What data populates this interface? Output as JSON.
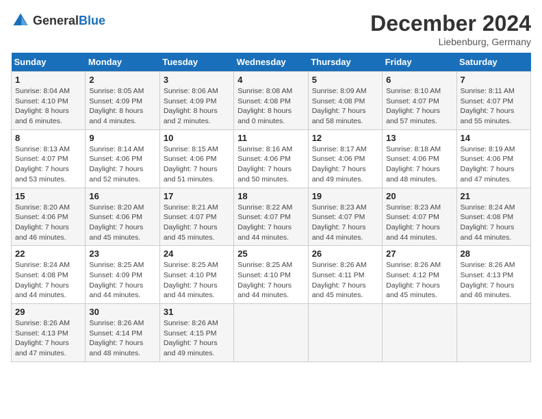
{
  "header": {
    "logo_general": "General",
    "logo_blue": "Blue",
    "month_title": "December 2024",
    "location": "Liebenburg, Germany"
  },
  "weekdays": [
    "Sunday",
    "Monday",
    "Tuesday",
    "Wednesday",
    "Thursday",
    "Friday",
    "Saturday"
  ],
  "weeks": [
    [
      {
        "day": "1",
        "sunrise": "Sunrise: 8:04 AM",
        "sunset": "Sunset: 4:10 PM",
        "daylight": "Daylight: 8 hours and 6 minutes."
      },
      {
        "day": "2",
        "sunrise": "Sunrise: 8:05 AM",
        "sunset": "Sunset: 4:09 PM",
        "daylight": "Daylight: 8 hours and 4 minutes."
      },
      {
        "day": "3",
        "sunrise": "Sunrise: 8:06 AM",
        "sunset": "Sunset: 4:09 PM",
        "daylight": "Daylight: 8 hours and 2 minutes."
      },
      {
        "day": "4",
        "sunrise": "Sunrise: 8:08 AM",
        "sunset": "Sunset: 4:08 PM",
        "daylight": "Daylight: 8 hours and 0 minutes."
      },
      {
        "day": "5",
        "sunrise": "Sunrise: 8:09 AM",
        "sunset": "Sunset: 4:08 PM",
        "daylight": "Daylight: 7 hours and 58 minutes."
      },
      {
        "day": "6",
        "sunrise": "Sunrise: 8:10 AM",
        "sunset": "Sunset: 4:07 PM",
        "daylight": "Daylight: 7 hours and 57 minutes."
      },
      {
        "day": "7",
        "sunrise": "Sunrise: 8:11 AM",
        "sunset": "Sunset: 4:07 PM",
        "daylight": "Daylight: 7 hours and 55 minutes."
      }
    ],
    [
      {
        "day": "8",
        "sunrise": "Sunrise: 8:13 AM",
        "sunset": "Sunset: 4:07 PM",
        "daylight": "Daylight: 7 hours and 53 minutes."
      },
      {
        "day": "9",
        "sunrise": "Sunrise: 8:14 AM",
        "sunset": "Sunset: 4:06 PM",
        "daylight": "Daylight: 7 hours and 52 minutes."
      },
      {
        "day": "10",
        "sunrise": "Sunrise: 8:15 AM",
        "sunset": "Sunset: 4:06 PM",
        "daylight": "Daylight: 7 hours and 51 minutes."
      },
      {
        "day": "11",
        "sunrise": "Sunrise: 8:16 AM",
        "sunset": "Sunset: 4:06 PM",
        "daylight": "Daylight: 7 hours and 50 minutes."
      },
      {
        "day": "12",
        "sunrise": "Sunrise: 8:17 AM",
        "sunset": "Sunset: 4:06 PM",
        "daylight": "Daylight: 7 hours and 49 minutes."
      },
      {
        "day": "13",
        "sunrise": "Sunrise: 8:18 AM",
        "sunset": "Sunset: 4:06 PM",
        "daylight": "Daylight: 7 hours and 48 minutes."
      },
      {
        "day": "14",
        "sunrise": "Sunrise: 8:19 AM",
        "sunset": "Sunset: 4:06 PM",
        "daylight": "Daylight: 7 hours and 47 minutes."
      }
    ],
    [
      {
        "day": "15",
        "sunrise": "Sunrise: 8:20 AM",
        "sunset": "Sunset: 4:06 PM",
        "daylight": "Daylight: 7 hours and 46 minutes."
      },
      {
        "day": "16",
        "sunrise": "Sunrise: 8:20 AM",
        "sunset": "Sunset: 4:06 PM",
        "daylight": "Daylight: 7 hours and 45 minutes."
      },
      {
        "day": "17",
        "sunrise": "Sunrise: 8:21 AM",
        "sunset": "Sunset: 4:07 PM",
        "daylight": "Daylight: 7 hours and 45 minutes."
      },
      {
        "day": "18",
        "sunrise": "Sunrise: 8:22 AM",
        "sunset": "Sunset: 4:07 PM",
        "daylight": "Daylight: 7 hours and 44 minutes."
      },
      {
        "day": "19",
        "sunrise": "Sunrise: 8:23 AM",
        "sunset": "Sunset: 4:07 PM",
        "daylight": "Daylight: 7 hours and 44 minutes."
      },
      {
        "day": "20",
        "sunrise": "Sunrise: 8:23 AM",
        "sunset": "Sunset: 4:07 PM",
        "daylight": "Daylight: 7 hours and 44 minutes."
      },
      {
        "day": "21",
        "sunrise": "Sunrise: 8:24 AM",
        "sunset": "Sunset: 4:08 PM",
        "daylight": "Daylight: 7 hours and 44 minutes."
      }
    ],
    [
      {
        "day": "22",
        "sunrise": "Sunrise: 8:24 AM",
        "sunset": "Sunset: 4:08 PM",
        "daylight": "Daylight: 7 hours and 44 minutes."
      },
      {
        "day": "23",
        "sunrise": "Sunrise: 8:25 AM",
        "sunset": "Sunset: 4:09 PM",
        "daylight": "Daylight: 7 hours and 44 minutes."
      },
      {
        "day": "24",
        "sunrise": "Sunrise: 8:25 AM",
        "sunset": "Sunset: 4:10 PM",
        "daylight": "Daylight: 7 hours and 44 minutes."
      },
      {
        "day": "25",
        "sunrise": "Sunrise: 8:25 AM",
        "sunset": "Sunset: 4:10 PM",
        "daylight": "Daylight: 7 hours and 44 minutes."
      },
      {
        "day": "26",
        "sunrise": "Sunrise: 8:26 AM",
        "sunset": "Sunset: 4:11 PM",
        "daylight": "Daylight: 7 hours and 45 minutes."
      },
      {
        "day": "27",
        "sunrise": "Sunrise: 8:26 AM",
        "sunset": "Sunset: 4:12 PM",
        "daylight": "Daylight: 7 hours and 45 minutes."
      },
      {
        "day": "28",
        "sunrise": "Sunrise: 8:26 AM",
        "sunset": "Sunset: 4:13 PM",
        "daylight": "Daylight: 7 hours and 46 minutes."
      }
    ],
    [
      {
        "day": "29",
        "sunrise": "Sunrise: 8:26 AM",
        "sunset": "Sunset: 4:13 PM",
        "daylight": "Daylight: 7 hours and 47 minutes."
      },
      {
        "day": "30",
        "sunrise": "Sunrise: 8:26 AM",
        "sunset": "Sunset: 4:14 PM",
        "daylight": "Daylight: 7 hours and 48 minutes."
      },
      {
        "day": "31",
        "sunrise": "Sunrise: 8:26 AM",
        "sunset": "Sunset: 4:15 PM",
        "daylight": "Daylight: 7 hours and 49 minutes."
      },
      null,
      null,
      null,
      null
    ]
  ]
}
